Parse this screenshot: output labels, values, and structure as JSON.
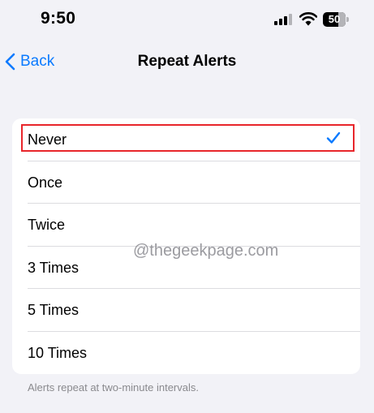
{
  "status_bar": {
    "time": "9:50",
    "battery_level": "50",
    "signal_bars_active": 3,
    "signal_bars_total": 4
  },
  "nav": {
    "back_label": "Back",
    "title": "Repeat Alerts"
  },
  "options": [
    {
      "label": "Never",
      "selected": true
    },
    {
      "label": "Once",
      "selected": false
    },
    {
      "label": "Twice",
      "selected": false
    },
    {
      "label": "3 Times",
      "selected": false
    },
    {
      "label": "5 Times",
      "selected": false
    },
    {
      "label": "10 Times",
      "selected": false
    }
  ],
  "footer_note": "Alerts repeat at two-minute intervals.",
  "watermark": "@thegeekpage.com",
  "colors": {
    "accent": "#0a7aff",
    "highlight": "#e8262b",
    "background": "#f2f2f7"
  },
  "icons": {
    "back": "chevron-left-icon",
    "selected": "checkmark-icon",
    "signal": "cellular-signal-icon",
    "wifi": "wifi-icon",
    "battery": "battery-icon"
  }
}
